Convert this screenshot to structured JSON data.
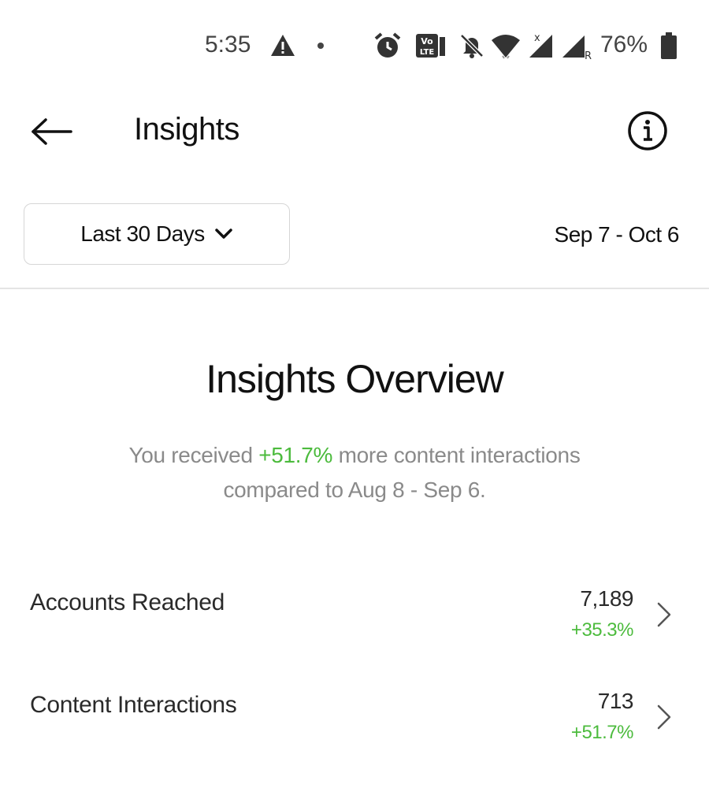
{
  "status_bar": {
    "time": "5:35",
    "battery": "76%",
    "icons": [
      "warning-icon",
      "dot-icon",
      "alarm-icon",
      "volte-icon",
      "bell-off-icon",
      "wifi-icon",
      "signal-icon",
      "signal-roaming-icon",
      "battery-icon"
    ]
  },
  "header": {
    "title": "Insights",
    "back_icon": "arrow-left-icon",
    "info_icon": "info-icon"
  },
  "filter": {
    "range_label": "Last 30 Days",
    "date_range": "Sep 7 - Oct 6"
  },
  "overview": {
    "title": "Insights Overview",
    "text_before": "You received ",
    "highlight": "+51.7%",
    "text_after": " more content interactions",
    "text_line2": "compared to Aug 8 - Sep 6."
  },
  "metrics": [
    {
      "label": "Accounts Reached",
      "value": "7,189",
      "change": "+35.3%"
    },
    {
      "label": "Content Interactions",
      "value": "713",
      "change": "+51.7%"
    }
  ],
  "colors": {
    "accent_green": "#4cbb3d",
    "text_primary": "#111111",
    "text_secondary": "#8a8a8a"
  }
}
